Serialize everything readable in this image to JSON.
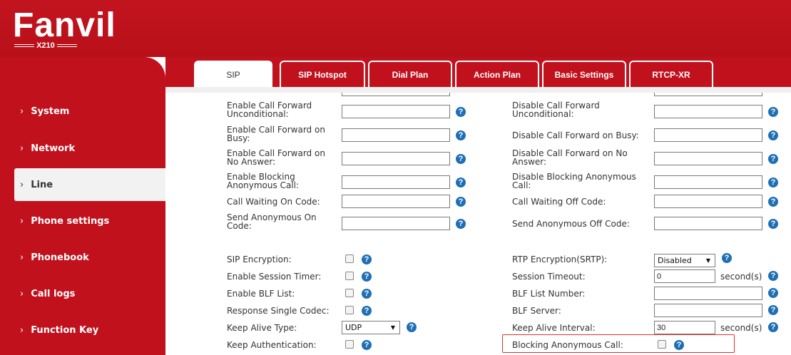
{
  "brand": {
    "logo": "Fanvil",
    "model": "X210"
  },
  "sidebar": {
    "items": [
      {
        "label": "System",
        "arrow": "›"
      },
      {
        "label": "Network",
        "arrow": "›"
      },
      {
        "label": "Line",
        "arrow": "›"
      },
      {
        "label": "Phone settings",
        "arrow": "›"
      },
      {
        "label": "Phonebook",
        "arrow": "›"
      },
      {
        "label": "Call logs",
        "arrow": "›"
      },
      {
        "label": "Function Key",
        "arrow": "›"
      }
    ],
    "active": "Line"
  },
  "tabs": [
    "SIP",
    "SIP Hotspot",
    "Dial Plan",
    "Action Plan",
    "Basic Settings",
    "RTCP-XR"
  ],
  "active_tab": "SIP",
  "help_glyph": "?",
  "left_fields": [
    {
      "label_1": "Enable Call Forward",
      "label_2": "Unconditional:",
      "value": ""
    },
    {
      "label_1": "Enable Call Forward on",
      "label_2": "Busy:",
      "value": ""
    },
    {
      "label_1": "Enable Call Forward on",
      "label_2": "No Answer:",
      "value": ""
    },
    {
      "label_1": "Enable Blocking",
      "label_2": "Anonymous Call:",
      "value": ""
    },
    {
      "label_1": "Call Waiting On Code:",
      "label_2": "",
      "value": ""
    },
    {
      "label_1": "Send Anonymous On",
      "label_2": "Code:",
      "value": ""
    }
  ],
  "right_fields": [
    {
      "label_1": "Disable Call Forward",
      "label_2": "Unconditional:",
      "value": ""
    },
    {
      "label_1": "Disable Call Forward on Busy:",
      "label_2": "",
      "value": ""
    },
    {
      "label_1": "Disable Call Forward on No",
      "label_2": "Answer:",
      "value": ""
    },
    {
      "label_1": "Disable Blocking Anonymous",
      "label_2": "Call:",
      "value": ""
    },
    {
      "label_1": "Call Waiting Off Code:",
      "label_2": "",
      "value": ""
    },
    {
      "label_1": "Send Anonymous Off Code:",
      "label_2": "",
      "value": ""
    }
  ],
  "left_options": [
    {
      "label": "SIP Encryption:",
      "type": "checkbox",
      "checked": false
    },
    {
      "label": "Enable Session Timer:",
      "type": "checkbox",
      "checked": false
    },
    {
      "label": "Enable BLF List:",
      "type": "checkbox",
      "checked": false
    },
    {
      "label": "Response Single Codec:",
      "type": "checkbox",
      "checked": false
    },
    {
      "label": "Keep Alive Type:",
      "type": "select",
      "value": "UDP"
    },
    {
      "label": "Keep Authentication:",
      "type": "checkbox",
      "checked": false
    }
  ],
  "right_options": [
    {
      "label": "RTP Encryption(SRTP):",
      "type": "select",
      "value": "Disabled"
    },
    {
      "label": "Session Timeout:",
      "type": "input",
      "value": "0",
      "unit": "second(s)"
    },
    {
      "label": "BLF List Number:",
      "type": "input",
      "value": ""
    },
    {
      "label": "BLF Server:",
      "type": "input",
      "value": ""
    },
    {
      "label": "Keep Alive Interval:",
      "type": "input",
      "value": "30",
      "unit": "second(s)"
    },
    {
      "label": "Blocking Anonymous Call:",
      "type": "checkbox",
      "checked": false,
      "highlighted": true
    }
  ],
  "colors": {
    "brand_red": "#c0111d",
    "help_blue": "#1f6fb5",
    "highlight": "#e0312d"
  }
}
